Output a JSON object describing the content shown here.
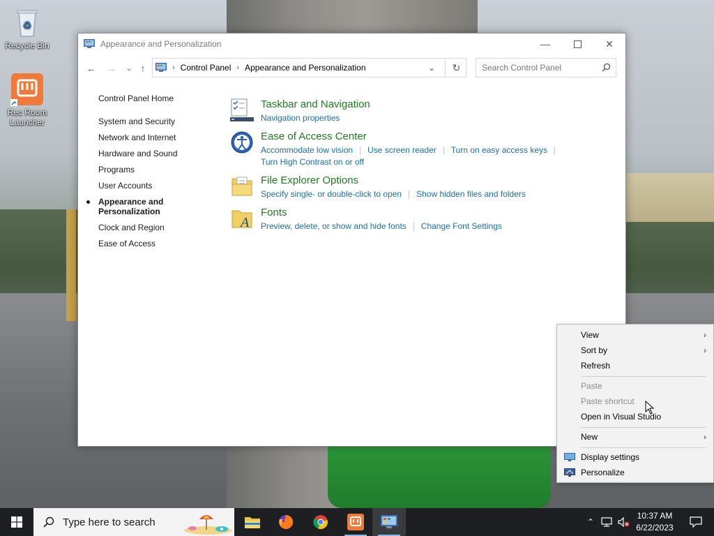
{
  "desktop": {
    "icons": [
      {
        "label": "Recycle Bin"
      },
      {
        "label": "Rec Room Launcher"
      }
    ]
  },
  "window": {
    "title": "Appearance and Personalization",
    "breadcrumb": [
      "Control Panel",
      "Appearance and Personalization"
    ],
    "search_placeholder": "Search Control Panel",
    "leftnav": {
      "home": "Control Panel Home",
      "items": [
        "System and Security",
        "Network and Internet",
        "Hardware and Sound",
        "Programs",
        "User Accounts",
        "Appearance and Personalization",
        "Clock and Region",
        "Ease of Access"
      ]
    },
    "sections": [
      {
        "heading": "Taskbar and Navigation",
        "icon": "taskbar-icon",
        "links": [
          "Navigation properties"
        ]
      },
      {
        "heading": "Ease of Access Center",
        "icon": "ease-of-access-icon",
        "links": [
          "Accommodate low vision",
          "Use screen reader",
          "Turn on easy access keys",
          "Turn High Contrast on or off"
        ]
      },
      {
        "heading": "File Explorer Options",
        "icon": "folder-options-icon",
        "links": [
          "Specify single- or double-click to open",
          "Show hidden files and folders"
        ]
      },
      {
        "heading": "Fonts",
        "icon": "fonts-icon",
        "links": [
          "Preview, delete, or show and hide fonts",
          "Change Font Settings"
        ]
      }
    ]
  },
  "context_menu": {
    "items": [
      {
        "label": "View",
        "submenu": true,
        "enabled": true
      },
      {
        "label": "Sort by",
        "submenu": true,
        "enabled": true
      },
      {
        "label": "Refresh",
        "enabled": true
      },
      {
        "label": "Paste",
        "enabled": false
      },
      {
        "label": "Paste shortcut",
        "enabled": false
      },
      {
        "label": "Open in Visual Studio",
        "enabled": true
      },
      {
        "label": "New",
        "submenu": true,
        "enabled": true
      },
      {
        "label": "Display settings",
        "enabled": true,
        "icon": "display-icon"
      },
      {
        "label": "Personalize",
        "enabled": true,
        "icon": "personalize-icon"
      }
    ]
  },
  "taskbar": {
    "search_placeholder": "Type here to search",
    "apps": [
      "file-explorer",
      "firefox",
      "chrome",
      "rec-room",
      "control-panel"
    ],
    "time": "10:37 AM",
    "date": "6/22/2023"
  },
  "colors": {
    "link": "#1a6fa8",
    "heading": "#1e7b1e",
    "taskbar": "#1e1f22"
  }
}
